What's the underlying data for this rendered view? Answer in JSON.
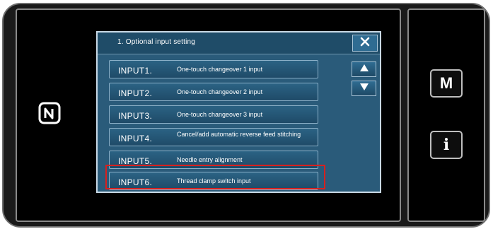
{
  "dialog": {
    "title": "1.  Optional input setting"
  },
  "inputs": [
    {
      "code": "INPUT1.",
      "desc": "One-touch changeover 1 input"
    },
    {
      "code": "INPUT2.",
      "desc": "One-touch changeover 2 input"
    },
    {
      "code": "INPUT3.",
      "desc": "One-touch changeover 3 input"
    },
    {
      "code": "INPUT4.",
      "desc": "Cancel/add automatic reverse feed stitching"
    },
    {
      "code": "INPUT5.",
      "desc": "Needle entry alignment"
    },
    {
      "code": "INPUT6.",
      "desc": "Thread clamp switch input"
    }
  ],
  "sidebar": {
    "mode_label": "M",
    "info_label": "i"
  },
  "icons": {
    "nfc": "nfc-icon",
    "close": "close-icon",
    "scroll_up": "triangle-up-icon",
    "scroll_down": "triangle-down-icon"
  },
  "colors": {
    "highlight": "#d8201e",
    "dialog_bg": "#2a5f80"
  }
}
